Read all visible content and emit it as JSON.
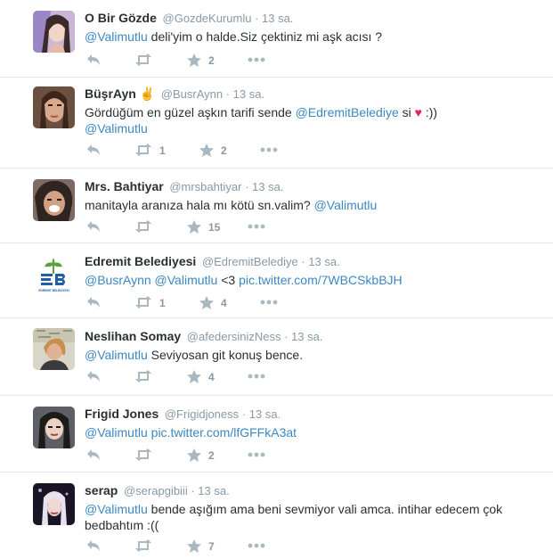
{
  "tweets": [
    {
      "fullname": "O Bir Gözde",
      "username": "@GozdeKurumlu",
      "time": "· 13 sa.",
      "text_parts": [
        "@Valimutlu",
        " deli'yim o halde.Siz çektiniz mi aşk acısı ?"
      ],
      "retweets": "",
      "favorites": "2"
    },
    {
      "fullname": "BüşrAyn ✌",
      "username": "@BusrAynn",
      "time": "· 13 sa.",
      "text_parts": [
        "Gördüğüm en güzel aşkın tarifi sende ",
        "@EdremitBelediye",
        " si ",
        "♥",
        " :))",
        "@Valimutlu"
      ],
      "retweets": "1",
      "favorites": "2"
    },
    {
      "fullname": "Mrs. Bahtiyar",
      "username": "@mrsbahtiyar",
      "time": "· 13 sa.",
      "text_parts": [
        "manitayla aranıza hala mı kötü sn.valim? ",
        "@Valimutlu"
      ],
      "retweets": "",
      "favorites": "15"
    },
    {
      "fullname": "Edremit Belediyesi",
      "username": "@EdremitBelediye",
      "time": "· 13 sa.",
      "text_parts": [
        "@BusrAynn",
        " ",
        "@Valimutlu",
        " <3 ",
        "pic.twitter.com/7WBCSkbBJH"
      ],
      "retweets": "1",
      "favorites": "4",
      "avatar_caption": "EDREMIT BELEDİYESİ"
    },
    {
      "fullname": "Neslihan Somay",
      "username": "@afedersinizNess",
      "time": "· 13 sa.",
      "text_parts": [
        "@Valimutlu",
        " Seviyosan git konuş bence."
      ],
      "retweets": "",
      "favorites": "4"
    },
    {
      "fullname": "Frigid Jones",
      "username": "@Frigidjoness",
      "time": "· 13 sa.",
      "text_parts": [
        "@Valimutlu",
        " ",
        "pic.twitter.com/lfGFFkA3at"
      ],
      "retweets": "",
      "favorites": "2"
    },
    {
      "fullname": "serap",
      "username": "@serapgibiii",
      "time": "· 13 sa.",
      "text_parts": [
        "@Valimutlu",
        " bende aşığım ama beni sevmiyor vali amca. intihar edecem çok bedbahtım :(("
      ],
      "retweets": "",
      "favorites": "7"
    }
  ],
  "icons": {
    "reply": "reply-icon",
    "retweet": "retweet-icon",
    "favorite": "star-icon",
    "more": "more-icon"
  },
  "colors": {
    "link": "#3b88c3",
    "muted": "#8899a6",
    "text": "#292f33",
    "border": "#e1e8ed",
    "heart": "#e0245e"
  }
}
